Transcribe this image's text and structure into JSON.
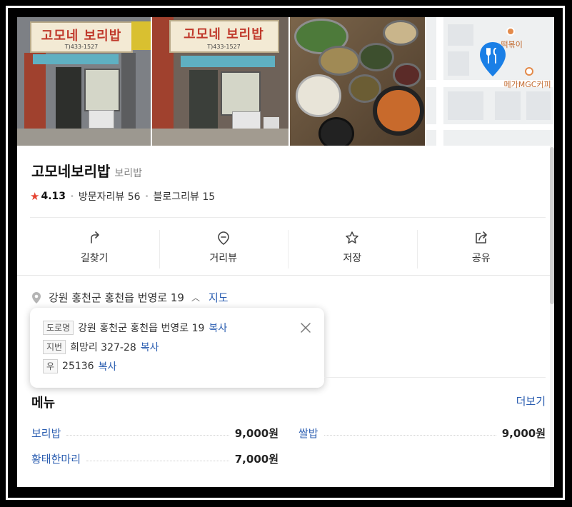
{
  "photos": {
    "store_sign": "고모네 보리밥",
    "store_sign_sub": "T)433-1527",
    "map_labels": [
      "떡볶이",
      "메가MGC커피"
    ]
  },
  "place": {
    "name": "고모네보리밥",
    "category": "보리밥",
    "rating": "4.13",
    "visitor_reviews": "방문자리뷰 56",
    "blog_reviews": "블로그리뷰 15"
  },
  "actions": [
    {
      "label": "길찾기",
      "icon": "directions-icon"
    },
    {
      "label": "거리뷰",
      "icon": "street-view-icon"
    },
    {
      "label": "저장",
      "icon": "star-icon"
    },
    {
      "label": "공유",
      "icon": "share-icon"
    }
  ],
  "address": {
    "main": "강원 홍천군 홍천읍 번영로 19",
    "map_link": "지도",
    "road_tag": "도로명",
    "road": "강원 홍천군 홍천읍 번영로 19",
    "lot_tag": "지번",
    "lot": "희망리 327-28",
    "zip_tag": "우",
    "zip": "25136",
    "copy_label": "복사"
  },
  "menu": {
    "title": "메뉴",
    "more": "더보기",
    "items": [
      {
        "name": "보리밥",
        "price": "9,000원"
      },
      {
        "name": "쌀밥",
        "price": "9,000원"
      },
      {
        "name": "황태한마리",
        "price": "7,000원"
      }
    ]
  },
  "colors": {
    "link": "#2a5db0",
    "star": "#e5412f",
    "map_pin": "#1a7fe6"
  }
}
